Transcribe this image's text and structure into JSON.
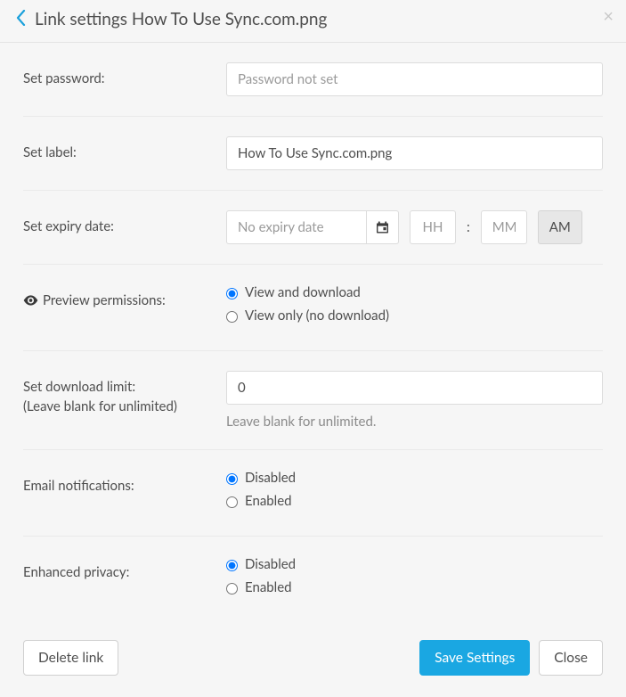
{
  "header": {
    "title": "Link settings How To Use Sync.com.png"
  },
  "password": {
    "label": "Set password:",
    "placeholder": "Password not set",
    "value": ""
  },
  "labelField": {
    "label": "Set label:",
    "value": "How To Use Sync.com.png"
  },
  "expiry": {
    "label": "Set expiry date:",
    "date_placeholder": "No expiry date",
    "date_value": "",
    "hh_placeholder": "HH",
    "hh_value": "",
    "mm_placeholder": "MM",
    "mm_value": "",
    "ampm": "AM",
    "colon": ":"
  },
  "preview": {
    "label": "Preview permissions:",
    "option_view_download": "View and download",
    "option_view_only": "View only (no download)",
    "selected": "view_download"
  },
  "download_limit": {
    "label_line1": "Set download limit:",
    "label_line2": "(Leave blank for unlimited)",
    "value": "0",
    "hint": "Leave blank for unlimited."
  },
  "email_notifications": {
    "label": "Email notifications:",
    "option_disabled": "Disabled",
    "option_enabled": "Enabled",
    "selected": "disabled"
  },
  "enhanced_privacy": {
    "label": "Enhanced privacy:",
    "option_disabled": "Disabled",
    "option_enabled": "Enabled",
    "selected": "disabled"
  },
  "footer": {
    "delete_label": "Delete link",
    "save_label": "Save Settings",
    "close_label": "Close"
  }
}
